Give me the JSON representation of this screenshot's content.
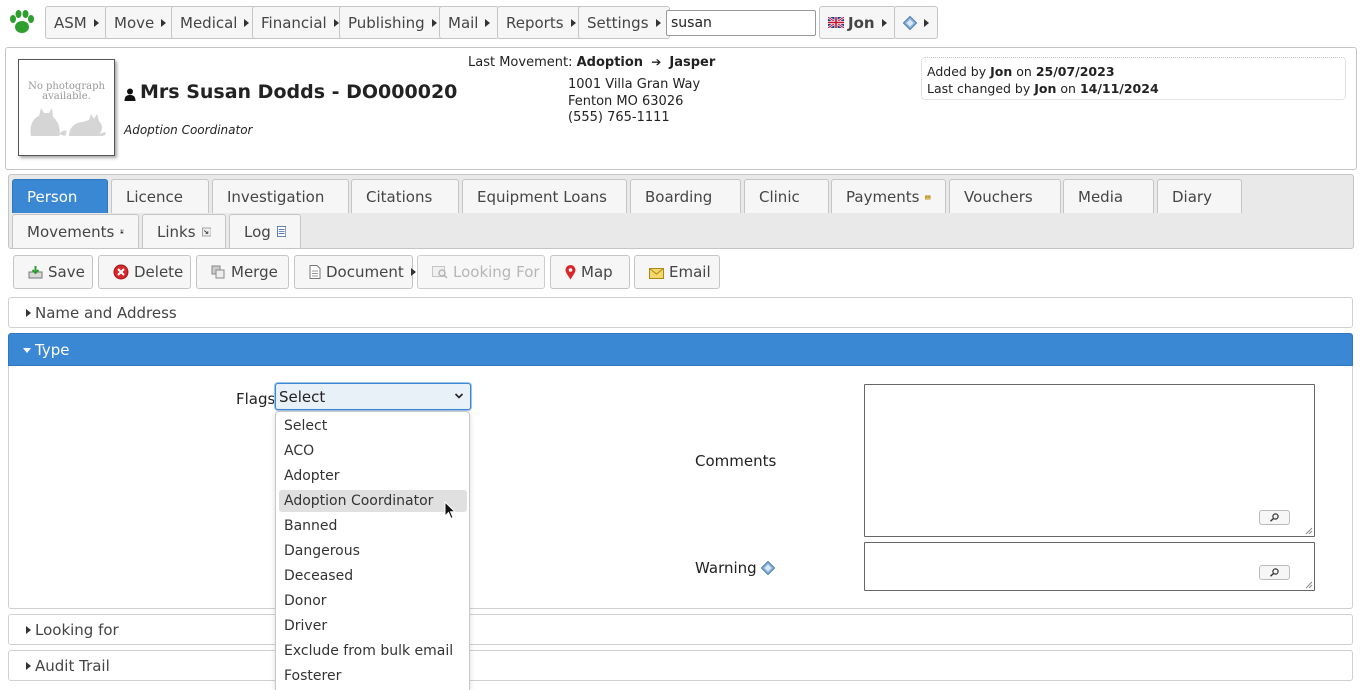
{
  "menu": {
    "items": [
      "ASM",
      "Move",
      "Medical",
      "Financial",
      "Publishing",
      "Mail",
      "Reports",
      "Settings"
    ],
    "search_value": "susan",
    "user": "Jon"
  },
  "person": {
    "photo_text": "No photograph available.",
    "name": "Mrs Susan Dodds - DO000020",
    "role": "Adoption Coordinator",
    "last_movement_label": "Last Movement:",
    "last_movement_type": "Adoption",
    "last_movement_animal": "Jasper",
    "address": [
      "1001 Villa Gran Way",
      "Fenton MO 63026",
      "(555) 765-1111"
    ]
  },
  "audit": {
    "added_prefix": "Added by",
    "added_by": "Jon",
    "on": "on",
    "added_date": "25/07/2023",
    "changed_prefix": "Last changed by",
    "changed_by": "Jon",
    "changed_date": "14/11/2024"
  },
  "tabs": [
    "Person",
    "Licence",
    "Investigation",
    "Citations",
    "Equipment Loans",
    "Boarding",
    "Clinic",
    "Payments",
    "Vouchers",
    "Media",
    "Diary",
    "Movements",
    "Links",
    "Log"
  ],
  "toolbar": {
    "save": "Save",
    "delete": "Delete",
    "merge": "Merge",
    "document": "Document",
    "looking_for": "Looking For",
    "map": "Map",
    "email": "Email"
  },
  "sections": {
    "name_address": "Name and Address",
    "type": "Type",
    "looking_for": "Looking for",
    "audit_trail": "Audit Trail"
  },
  "type_form": {
    "flags_label": "Flags",
    "flags_value": "Select",
    "comments_label": "Comments",
    "warning_label": "Warning"
  },
  "flag_options": [
    "Select",
    "ACO",
    "Adopter",
    "Adoption Coordinator",
    "Banned",
    "Dangerous",
    "Deceased",
    "Donor",
    "Driver",
    "Exclude from bulk email",
    "Fosterer"
  ],
  "highlighted_option": "Adoption Coordinator",
  "colors": {
    "accent": "#3a87d4",
    "logo_green": "#2e9e2e"
  }
}
